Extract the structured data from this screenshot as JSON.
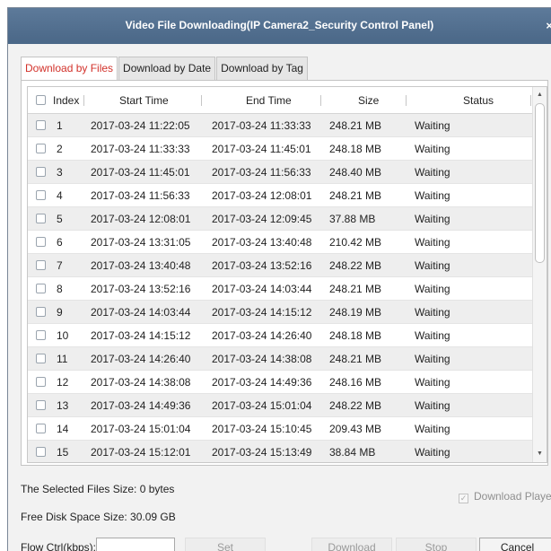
{
  "window": {
    "title": "Video File Downloading(IP Camera2_Security Control Panel)",
    "close_glyph": "×"
  },
  "tabs": [
    {
      "label": "Download by Files",
      "active": true
    },
    {
      "label": "Download by Date",
      "active": false
    },
    {
      "label": "Download by Tag",
      "active": false
    }
  ],
  "table": {
    "columns": [
      "Index",
      "Start Time",
      "End Time",
      "Size",
      "Status"
    ],
    "rows": [
      {
        "index": "1",
        "start": "2017-03-24 11:22:05",
        "end": "2017-03-24 11:33:33",
        "size": "248.21 MB",
        "status": "Waiting"
      },
      {
        "index": "2",
        "start": "2017-03-24 11:33:33",
        "end": "2017-03-24 11:45:01",
        "size": "248.18 MB",
        "status": "Waiting"
      },
      {
        "index": "3",
        "start": "2017-03-24 11:45:01",
        "end": "2017-03-24 11:56:33",
        "size": "248.40 MB",
        "status": "Waiting"
      },
      {
        "index": "4",
        "start": "2017-03-24 11:56:33",
        "end": "2017-03-24 12:08:01",
        "size": "248.21 MB",
        "status": "Waiting"
      },
      {
        "index": "5",
        "start": "2017-03-24 12:08:01",
        "end": "2017-03-24 12:09:45",
        "size": "37.88 MB",
        "status": "Waiting"
      },
      {
        "index": "6",
        "start": "2017-03-24 13:31:05",
        "end": "2017-03-24 13:40:48",
        "size": "210.42 MB",
        "status": "Waiting"
      },
      {
        "index": "7",
        "start": "2017-03-24 13:40:48",
        "end": "2017-03-24 13:52:16",
        "size": "248.22 MB",
        "status": "Waiting"
      },
      {
        "index": "8",
        "start": "2017-03-24 13:52:16",
        "end": "2017-03-24 14:03:44",
        "size": "248.21 MB",
        "status": "Waiting"
      },
      {
        "index": "9",
        "start": "2017-03-24 14:03:44",
        "end": "2017-03-24 14:15:12",
        "size": "248.19 MB",
        "status": "Waiting"
      },
      {
        "index": "10",
        "start": "2017-03-24 14:15:12",
        "end": "2017-03-24 14:26:40",
        "size": "248.18 MB",
        "status": "Waiting"
      },
      {
        "index": "11",
        "start": "2017-03-24 14:26:40",
        "end": "2017-03-24 14:38:08",
        "size": "248.21 MB",
        "status": "Waiting"
      },
      {
        "index": "12",
        "start": "2017-03-24 14:38:08",
        "end": "2017-03-24 14:49:36",
        "size": "248.16 MB",
        "status": "Waiting"
      },
      {
        "index": "13",
        "start": "2017-03-24 14:49:36",
        "end": "2017-03-24 15:01:04",
        "size": "248.22 MB",
        "status": "Waiting"
      },
      {
        "index": "14",
        "start": "2017-03-24 15:01:04",
        "end": "2017-03-24 15:10:45",
        "size": "209.43 MB",
        "status": "Waiting"
      },
      {
        "index": "15",
        "start": "2017-03-24 15:12:01",
        "end": "2017-03-24 15:13:49",
        "size": "38.84 MB",
        "status": "Waiting"
      }
    ]
  },
  "footer": {
    "selected_size": "The Selected Files Size:  0 bytes",
    "free_disk": "Free Disk Space Size:  30.09 GB",
    "flow_label": "Flow Ctrl(kbps):",
    "flow_value": "",
    "download_player": "Download Player",
    "download_player_checked": true
  },
  "buttons": {
    "set": "Set",
    "download": "Download",
    "stop": "Stop",
    "cancel": "Cancel"
  },
  "colors": {
    "titlebar": "#4f6c8c",
    "active_tab_text": "#d2312a",
    "row_alt": "#eeeeee"
  }
}
